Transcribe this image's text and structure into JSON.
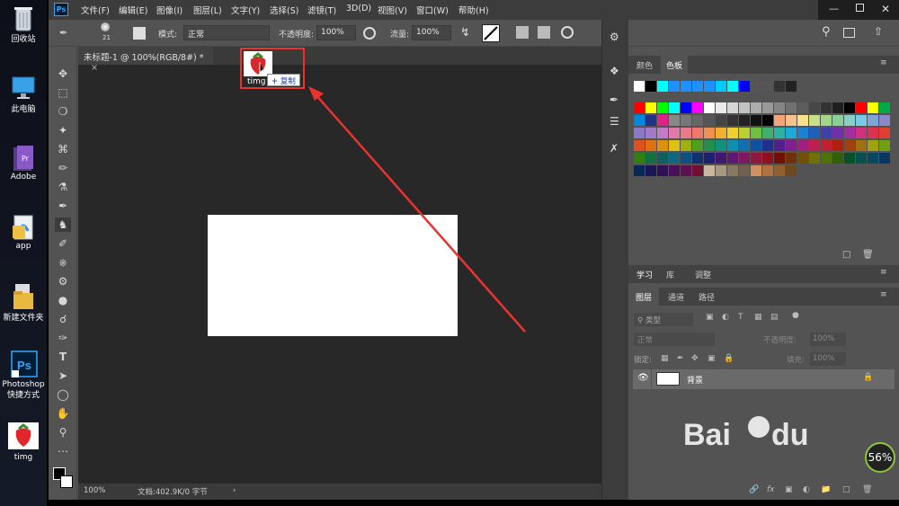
{
  "desktop": {
    "icons": [
      {
        "label": "回收站",
        "icon": "recycle-bin-icon"
      },
      {
        "label": "此电脑",
        "icon": "computer-icon"
      },
      {
        "label": "Adobe",
        "icon": "folder-icon"
      },
      {
        "label": "app",
        "icon": "folder-icon"
      },
      {
        "label": "新建文件夹",
        "icon": "folder-icon"
      },
      {
        "label": "Photoshop\n快捷方式",
        "icon": "photoshop-icon"
      },
      {
        "label": "timg",
        "icon": "strawberry-image-icon"
      }
    ]
  },
  "app": {
    "logo": "Ps",
    "menu": [
      "文件(F)",
      "编辑(E)",
      "图像(I)",
      "图层(L)",
      "文字(Y)",
      "选择(S)",
      "滤镜(T)",
      "3D(D)",
      "视图(V)",
      "窗口(W)",
      "帮助(H)"
    ]
  },
  "options": {
    "brush_size": "21",
    "mode_label": "模式:",
    "mode_value": "正常",
    "opacity_label": "不透明度:",
    "opacity_value": "100%",
    "flow_label": "流量:",
    "flow_value": "100%"
  },
  "document": {
    "tab_title": "未标题-1 @ 100%(RGB/8#) *",
    "close": "×",
    "zoom": "100%",
    "doc_info": "文档:402.9K/0 字节"
  },
  "drag": {
    "filename": "timg",
    "tooltip": "复制",
    "tooltip_plus": "+"
  },
  "panels": {
    "color_tabs": [
      "颜色",
      "色板"
    ],
    "learn_tabs": [
      "学习",
      "库",
      "调整"
    ],
    "layer_tabs": [
      "图层",
      "通道",
      "路径"
    ],
    "filter_kind": "类型",
    "blend_mode": "正常",
    "opacity_label": "不透明度:",
    "opacity_value": "100%",
    "lock_label": "锁定:",
    "fill_label": "填充:",
    "fill_value": "100%",
    "layer_name": "背景"
  },
  "swatch_colors": {
    "row0": [
      "#ffffff",
      "#000000",
      "#00ffff",
      "#1e90ff",
      "#1e90ff",
      "#1e90ff",
      "#1e90ff",
      "#00ccff",
      "#00ffff",
      "#0000ff",
      "#555555",
      "#555555",
      "#333333",
      "#222222"
    ],
    "grid": [
      [
        "#ff0000",
        "#ffff00",
        "#00ff00",
        "#00ffff",
        "#0000ff",
        "#ff00ff",
        "#ffffff",
        "#ebebeb",
        "#d6d6d6",
        "#c2c2c2",
        "#adadad",
        "#999999",
        "#858585",
        "#707070",
        "#5c5c5c",
        "#474747",
        "#333333",
        "#1f1f1f",
        "#000000",
        "#ff0000",
        "#ffff00",
        "#00aa44"
      ],
      [
        "#0088dd",
        "#223388",
        "#dd2288",
        "#888888",
        "#777777",
        "#666666",
        "#555555",
        "#444444",
        "#333333",
        "#222222",
        "#111111",
        "#000000",
        "#f5a37a",
        "#f8c08a",
        "#f9df8a",
        "#c9e08a",
        "#a5d38a",
        "#88cf9a",
        "#86d0c5",
        "#7ac8e8",
        "#7ea4d8",
        "#8b8ac8"
      ],
      [
        "#8a7ac5",
        "#a27ac5",
        "#c47ac5",
        "#e07aa8",
        "#e87a8a",
        "#f07a6a",
        "#f09050",
        "#f0b030",
        "#f0d030",
        "#b8d030",
        "#70c040",
        "#40b070",
        "#30b0a0",
        "#20a8d8",
        "#2080d0",
        "#2060b8",
        "#4040a8",
        "#7030a8",
        "#a030a0",
        "#d03080",
        "#e03050",
        "#e04030"
      ],
      [
        "#e05020",
        "#e07010",
        "#e09010",
        "#e0c010",
        "#a0b010",
        "#50a020",
        "#20904a",
        "#109080",
        "#1090b0",
        "#1070b0",
        "#1050a0",
        "#203090",
        "#502090",
        "#802090",
        "#a02080",
        "#c02050",
        "#c02030",
        "#b02010",
        "#a04010",
        "#a07010",
        "#a0a010",
        "#70a010"
      ],
      [
        "#308010",
        "#107040",
        "#106060",
        "#106880",
        "#105080",
        "#103070",
        "#202070",
        "#401870",
        "#601870",
        "#801860",
        "#901840",
        "#901020",
        "#701008",
        "#703008",
        "#705008",
        "#707008",
        "#507008",
        "#306008",
        "#085028",
        "#085050",
        "#084860",
        "#083860"
      ],
      [
        "#082858",
        "#181858",
        "#301058",
        "#481058",
        "#601050",
        "#701030",
        "#c8b8a0",
        "#a89880",
        "#887860",
        "#706050",
        "#d09060",
        "#b07040",
        "#906030",
        "#704820"
      ]
    ]
  }
}
